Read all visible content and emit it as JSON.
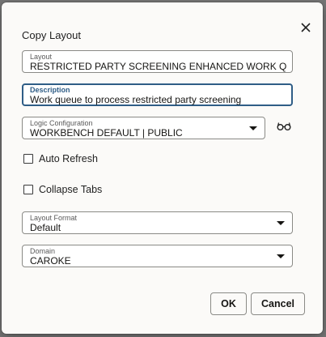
{
  "dialog": {
    "title": "Copy Layout",
    "close_icon": "close-icon"
  },
  "fields": {
    "layout": {
      "label": "Layout",
      "value": "RESTRICTED PARTY SCREENING ENHANCED WORK QU"
    },
    "description": {
      "label": "Description",
      "value": "Work queue to process restricted party screening"
    },
    "logic_configuration": {
      "label": "Logic Configuration",
      "value": "WORKBENCH DEFAULT | PUBLIC",
      "view_icon": "glasses-icon"
    },
    "layout_format": {
      "label": "Layout Format",
      "value": "Default"
    },
    "domain": {
      "label": "Domain",
      "value": "CAROKE"
    }
  },
  "checkboxes": {
    "auto_refresh": {
      "label": "Auto Refresh",
      "checked": false
    },
    "collapse_tabs": {
      "label": "Collapse Tabs",
      "checked": false
    }
  },
  "buttons": {
    "ok": "OK",
    "cancel": "Cancel"
  },
  "colors": {
    "focus_border": "#2f5d86",
    "dialog_bg": "#fbfaf8",
    "backdrop": "#777777"
  }
}
